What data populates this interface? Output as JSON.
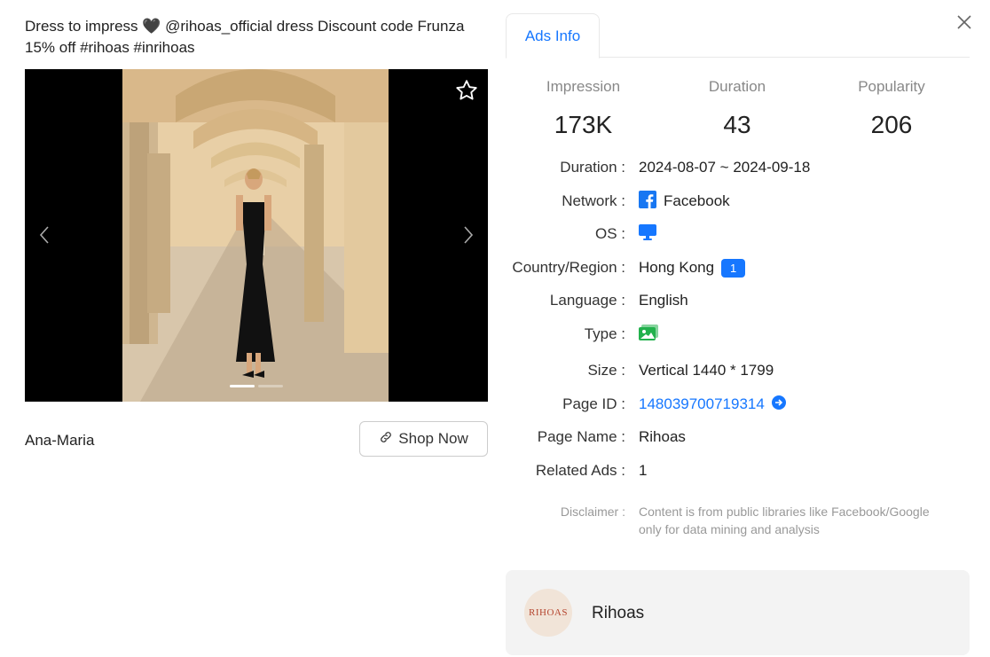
{
  "ad": {
    "caption_line1": "Dress to impress 🖤 @rihoas_official dress Discount code Frunza",
    "caption_line2": "15% off #rihoas #inrihoas",
    "advertiser": "Ana-Maria",
    "cta_label": "Shop Now"
  },
  "tabs": {
    "ads_info": "Ads Info"
  },
  "stats": [
    {
      "label": "Impression",
      "value": "173K"
    },
    {
      "label": "Duration",
      "value": "43"
    },
    {
      "label": "Popularity",
      "value": "206"
    }
  ],
  "details": {
    "duration": {
      "label": "Duration :",
      "value": "2024-08-07 ~ 2024-09-18"
    },
    "network": {
      "label": "Network :",
      "value": "Facebook",
      "icon": "facebook-icon"
    },
    "os": {
      "label": "OS :",
      "icon": "desktop-icon"
    },
    "country": {
      "label": "Country/Region :",
      "value": "Hong Kong",
      "badge": "1"
    },
    "language": {
      "label": "Language :",
      "value": "English"
    },
    "type": {
      "label": "Type :",
      "icon": "image-icon"
    },
    "size": {
      "label": "Size :",
      "value": "Vertical 1440 * 1799"
    },
    "page_id": {
      "label": "Page ID :",
      "value": "148039700719314"
    },
    "page_name": {
      "label": "Page Name :",
      "value": "Rihoas"
    },
    "related_ads": {
      "label": "Related Ads :",
      "value": "1"
    }
  },
  "disclaimer": {
    "label": "Disclaimer :",
    "line1": "Content is from public libraries like Facebook/Google",
    "line2": "only for data mining and analysis"
  },
  "page_card": {
    "logo_text": "RIHOAS",
    "name": "Rihoas"
  },
  "colors": {
    "accent": "#1677ff",
    "facebook": "#1877f2",
    "type_icon": "#22b14c"
  }
}
